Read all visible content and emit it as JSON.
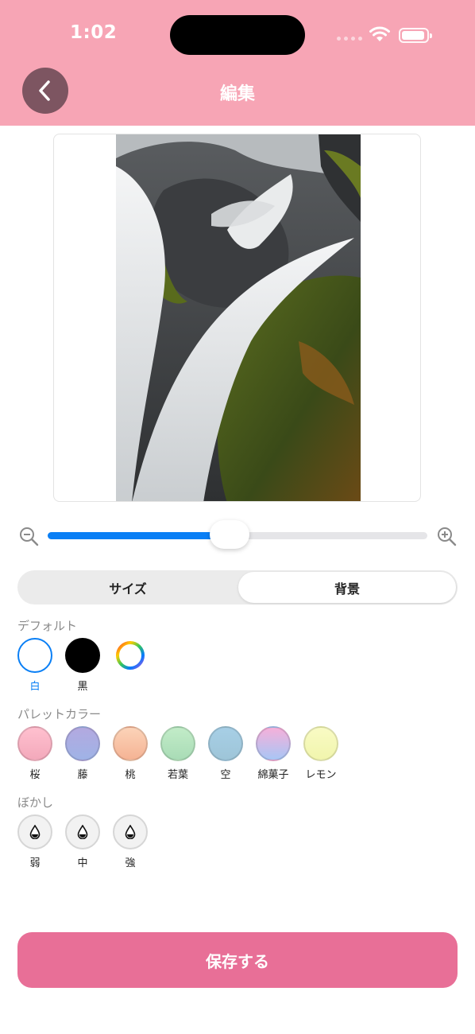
{
  "status_bar": {
    "time": "1:02"
  },
  "header": {
    "title": "編集",
    "back_icon": "chevron-left-icon"
  },
  "zoom": {
    "level": 0.48,
    "zoom_out_icon": "zoom-out-icon",
    "zoom_in_icon": "zoom-in-icon"
  },
  "tabs": [
    {
      "label": "サイズ",
      "active": false
    },
    {
      "label": "背景",
      "active": true
    }
  ],
  "default_section": {
    "title": "デフォルト",
    "items": [
      {
        "label": "白",
        "color": "#ffffff",
        "selected": true
      },
      {
        "label": "黒",
        "color": "#000000",
        "selected": false
      },
      {
        "label": "",
        "icon": "color-wheel-icon",
        "selected": false
      }
    ]
  },
  "palette_section": {
    "title": "パレットカラー",
    "items": [
      {
        "label": "桜",
        "color_top": "#ffc0cf",
        "color_bottom": "#f3a9bb"
      },
      {
        "label": "藤",
        "color_top": "#b3a9e0",
        "color_bottom": "#9fb3e6"
      },
      {
        "label": "桃",
        "color_top": "#fcd3b8",
        "color_bottom": "#f5b394"
      },
      {
        "label": "若葉",
        "color_top": "#c2ecc8",
        "color_bottom": "#a9dcb6"
      },
      {
        "label": "空",
        "color_top": "#a7cfe6",
        "color_bottom": "#9ec5d8"
      },
      {
        "label": "綿菓子",
        "color_top": "#f6b0da",
        "color_bottom": "#a8c6f5"
      },
      {
        "label": "レモン",
        "color_top": "#f9fbc4",
        "color_bottom": "#f1f5ad"
      }
    ]
  },
  "blur_section": {
    "title": "ぼかし",
    "items": [
      {
        "label": "弱",
        "icon": "droplet-icon"
      },
      {
        "label": "中",
        "icon": "droplet-icon"
      },
      {
        "label": "強",
        "icon": "droplet-icon"
      }
    ]
  },
  "save_button": {
    "label": "保存する"
  },
  "colors": {
    "header": "#f7a5b5",
    "accent": "#0a7ff5",
    "save": "#e86f97"
  }
}
